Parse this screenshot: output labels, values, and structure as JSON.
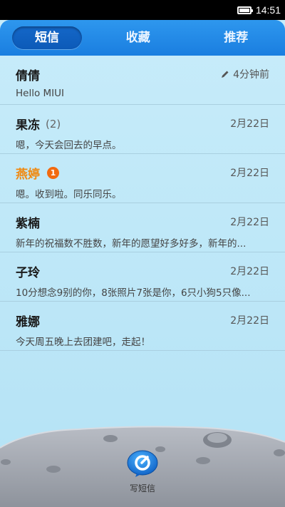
{
  "status_bar": {
    "time": "14:51",
    "battery_level": 1.0
  },
  "tabs": [
    {
      "label": "短信",
      "active": true
    },
    {
      "label": "收藏",
      "active": false
    },
    {
      "label": "推荐",
      "active": false
    }
  ],
  "messages": [
    {
      "name": "倩倩",
      "count": "",
      "badge": "",
      "preview": "Hello MIUI",
      "date": "4分钟前",
      "draft_icon": "pencil-icon"
    },
    {
      "name": "果冻",
      "count": "(2)",
      "badge": "",
      "preview": "嗯，今天会回去的早点。",
      "date": "2月22日"
    },
    {
      "name": "燕婷",
      "count": "",
      "badge": "1",
      "preview": "嗯。收到啦。同乐同乐。",
      "date": "2月22日",
      "name_color": "#f08a12"
    },
    {
      "name": "紫楠",
      "count": "",
      "badge": "",
      "preview": "新年的祝福数不胜数，新年的愿望好多好多，新年的...",
      "date": "2月22日"
    },
    {
      "name": "子玲",
      "count": "",
      "badge": "",
      "preview": "10分想念9别的你，8张照片7张是你，6只小狗5只像...",
      "date": "2月22日"
    },
    {
      "name": "雅娜",
      "count": "",
      "badge": "",
      "preview": "今天周五晚上去团建吧，走起！",
      "date": "2月22日"
    }
  ],
  "compose": {
    "label": "写短信",
    "icon": "compose-icon"
  },
  "colors": {
    "tab_bar": "#1a7ee0",
    "background": "#c8ecfa",
    "unread": "#f26a10"
  }
}
